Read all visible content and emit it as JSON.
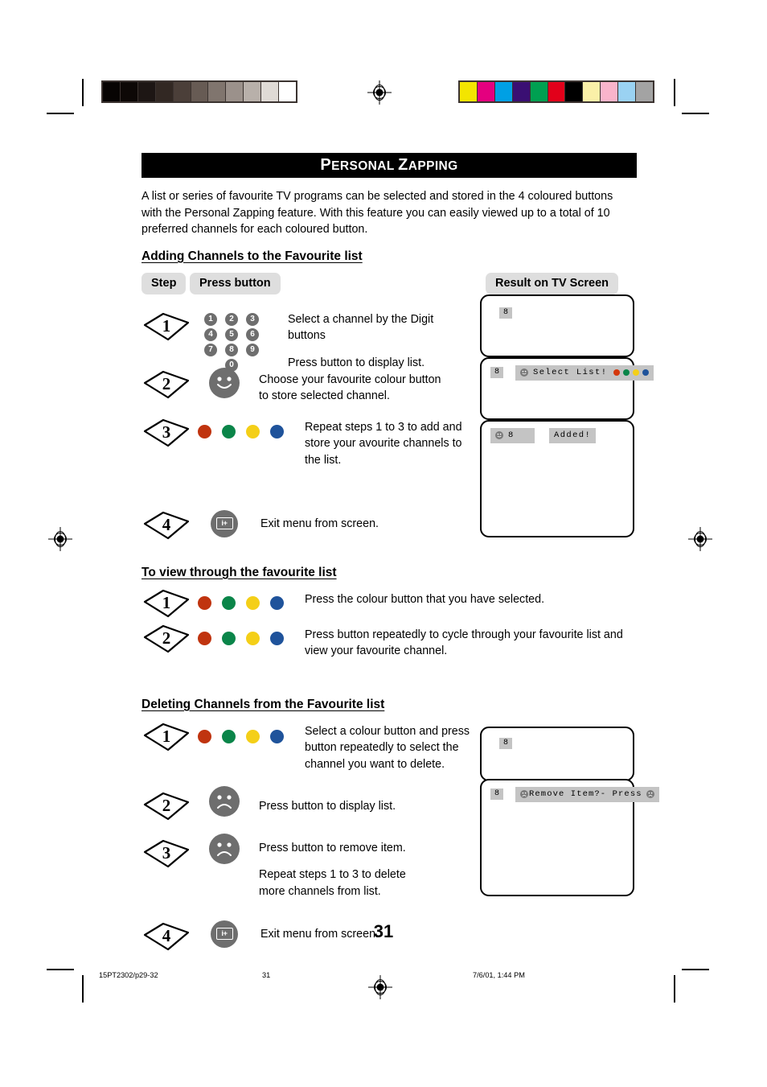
{
  "document": {
    "title": "Personal Zapping",
    "title_caps": {
      "p": "P",
      "rest1": "ERSONAL ",
      "z": "Z",
      "rest2": "APPING"
    },
    "intro": "A list or series of favourite TV programs can be selected and stored in the 4 coloured buttons with the Personal Zapping feature. With this feature you can easily viewed up to a total of 10 preferred channels for each coloured button.",
    "page_number": "31"
  },
  "table_headers": {
    "step": "Step",
    "press_button": "Press button",
    "result": "Result on TV Screen"
  },
  "sections": [
    {
      "id": "adding",
      "heading": "Adding Channels to the Favourite list",
      "steps": [
        {
          "number": "1",
          "button_type": "keypad",
          "lines": [
            "Select a channel by the Digit buttons",
            "Press button to display list."
          ]
        },
        {
          "number": "2",
          "button_type": "smiley",
          "lines": [
            "Choose your favourite colour button to store selected channel."
          ]
        },
        {
          "number": "3",
          "button_type": "colour-dots",
          "lines": [
            "Repeat steps 1 to 3 to add and store your avourite channels to the list."
          ]
        },
        {
          "number": "4",
          "button_type": "info-exit",
          "lines": [
            "Exit menu from screen."
          ]
        }
      ]
    },
    {
      "id": "viewing",
      "heading": "To view through the favourite list",
      "steps": [
        {
          "number": "1",
          "button_type": "colour-dots",
          "lines": [
            "Press the colour button that you have selected."
          ]
        },
        {
          "number": "2",
          "button_type": "colour-dots",
          "lines": [
            "Press button repeatedly to cycle through your favourite list and view your favourite channel."
          ]
        }
      ]
    },
    {
      "id": "deleting",
      "heading": "Deleting Channels from the Favourite list",
      "steps": [
        {
          "number": "1",
          "button_type": "colour-dots",
          "lines": [
            "Select a colour button and press button repeatedly to select the channel you want to delete."
          ]
        },
        {
          "number": "2",
          "button_type": "frowny",
          "lines": [
            "Press button to display list."
          ]
        },
        {
          "number": "3",
          "button_type": "frowny",
          "lines": [
            "Press button to remove item.",
            "Repeat steps 1 to 3 to delete more channels from list."
          ]
        },
        {
          "number": "4",
          "button_type": "info-exit",
          "lines": [
            "Exit menu from screen."
          ]
        }
      ]
    }
  ],
  "keypad": {
    "keys": [
      "1",
      "2",
      "3",
      "4",
      "5",
      "6",
      "7",
      "8",
      "9",
      "0"
    ]
  },
  "colour_buttons": [
    {
      "name": "red-button",
      "hex": "#c0340f"
    },
    {
      "name": "green-button",
      "hex": "#0a8549"
    },
    {
      "name": "yellow-button",
      "hex": "#f4cf18"
    },
    {
      "name": "blue-button",
      "hex": "#1f539b"
    }
  ],
  "info_button_label": "i+",
  "tv_screens": {
    "adding": [
      {
        "id": "tv-adding-1",
        "channel": "8",
        "osd": null
      },
      {
        "id": "tv-adding-2",
        "channel": "8",
        "osd": {
          "text": "Select List!",
          "has_face": true,
          "face": "smiley",
          "trailing_dots": true
        }
      },
      {
        "id": "tv-adding-3",
        "channel": "8",
        "osd": {
          "text": "Added!",
          "has_face": true,
          "face": "smiley",
          "trailing_dots": false,
          "style": "added"
        }
      }
    ],
    "deleting": [
      {
        "id": "tv-deleting-1",
        "channel": "8",
        "osd": null
      },
      {
        "id": "tv-deleting-2",
        "channel": "8",
        "osd": {
          "text": "Remove Item?- Press",
          "has_face": true,
          "face": "frowny",
          "trailing_face": true
        }
      }
    ]
  },
  "print_marks": {
    "greyscale_bar": [
      "#070403",
      "#0d0806",
      "#1d1614",
      "#322823",
      "#4b3f39",
      "#675b54",
      "#80756e",
      "#9b918b",
      "#b8b0aa",
      "#dfdad5",
      "#ffffff"
    ],
    "colour_bar": [
      "#f3e500",
      "#e4007f",
      "#00a0e4",
      "#3a0f73",
      "#00a051",
      "#e2001a",
      "#000000",
      "#faf0a8",
      "#f9b4cb",
      "#9ad2f2",
      "#a3a3a3"
    ]
  },
  "footer": {
    "file_ref": "15PT2302/p29-32",
    "page": "31",
    "datestamp": "7/6/01, 1:44 PM"
  }
}
